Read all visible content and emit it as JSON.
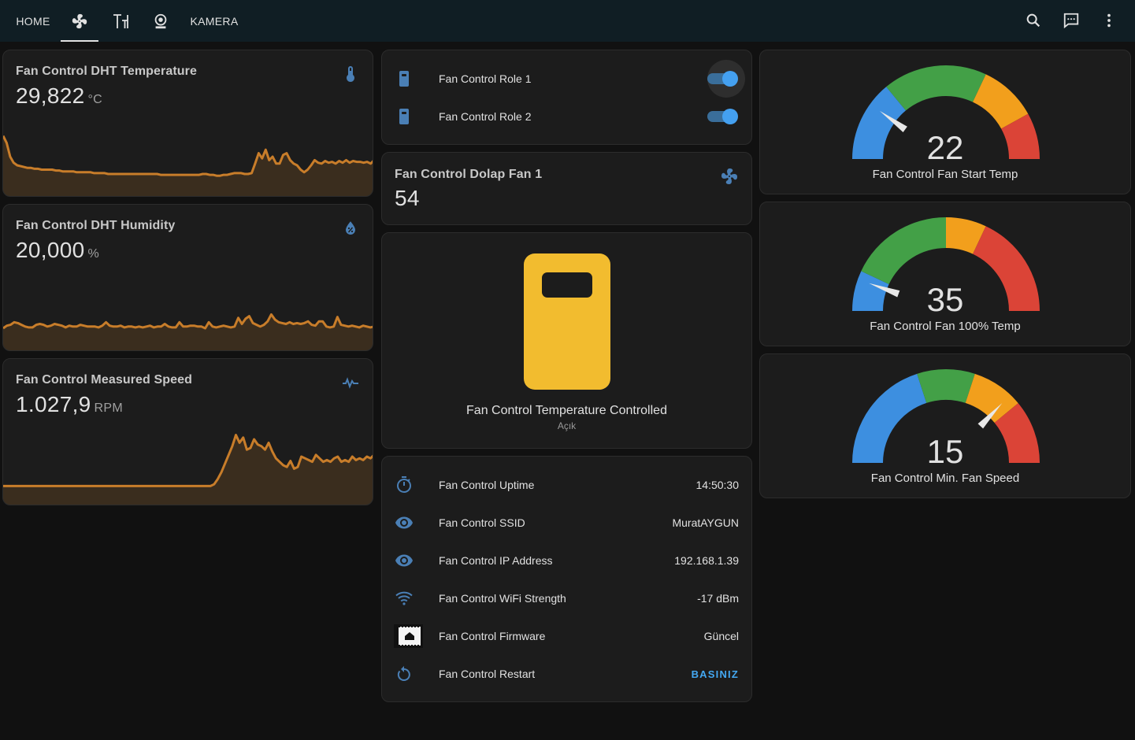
{
  "topbar": {
    "tabs": [
      {
        "label": "HOME",
        "kind": "text",
        "active": false
      },
      {
        "icon": "fan-icon",
        "active": true
      },
      {
        "icon": "text-tool-icon",
        "active": false
      },
      {
        "icon": "webcam-icon",
        "active": false
      },
      {
        "label": "KAMERA",
        "kind": "text",
        "active": false
      }
    ],
    "actions": [
      "search-icon",
      "message-icon",
      "more-vertical-icon"
    ]
  },
  "sensors": [
    {
      "name": "Fan Control DHT Temperature",
      "value": "29,822",
      "unit": "°C",
      "icon": "thermometer-icon",
      "history": [
        64,
        56,
        40,
        33,
        30,
        29,
        28,
        27,
        27,
        26,
        26,
        25,
        25,
        25,
        25,
        24,
        24,
        23,
        23,
        23,
        23,
        22,
        22,
        22,
        22,
        22,
        21,
        21,
        21,
        21,
        20,
        20,
        20,
        20,
        20,
        20,
        20,
        20,
        20,
        20,
        20,
        20,
        20,
        20,
        20,
        19,
        19,
        19,
        19,
        19,
        19,
        19,
        19,
        19,
        19,
        19,
        19,
        20,
        20,
        19,
        19,
        18,
        18,
        19,
        19,
        20,
        21,
        21,
        21,
        20,
        20,
        21,
        32,
        44,
        38,
        48,
        36,
        40,
        32,
        32,
        42,
        44,
        36,
        32,
        30,
        25,
        22,
        25,
        30,
        36,
        33,
        32,
        35,
        33,
        34,
        32,
        35,
        33,
        36,
        33,
        35,
        34,
        34,
        33,
        34,
        32,
        36
      ]
    },
    {
      "name": "Fan Control DHT Humidity",
      "value": "20,000",
      "unit": "%",
      "icon": "water-percent-icon",
      "history": [
        20,
        23,
        24,
        27,
        26,
        24,
        22,
        21,
        21,
        24,
        25,
        24,
        22,
        23,
        25,
        24,
        23,
        21,
        23,
        22,
        22,
        24,
        23,
        22,
        22,
        22,
        21,
        23,
        27,
        23,
        22,
        22,
        23,
        21,
        22,
        22,
        21,
        22,
        21,
        22,
        23,
        21,
        22,
        22,
        25,
        22,
        21,
        21,
        27,
        22,
        22,
        23,
        23,
        22,
        22,
        20,
        27,
        22,
        21,
        22,
        23,
        22,
        21,
        22,
        32,
        25,
        31,
        34,
        26,
        24,
        22,
        24,
        28,
        36,
        30,
        27,
        26,
        25,
        27,
        25,
        26,
        25,
        26,
        28,
        24,
        23,
        28,
        28,
        22,
        21,
        22,
        33,
        24,
        23,
        22,
        23,
        22,
        21,
        23,
        22,
        21,
        22
      ]
    },
    {
      "name": "Fan Control Measured Speed",
      "value": "1.027,9",
      "unit": "RPM",
      "icon": "pulse-icon",
      "history": [
        16,
        16,
        16,
        16,
        16,
        16,
        16,
        16,
        16,
        16,
        16,
        16,
        16,
        16,
        16,
        16,
        16,
        16,
        16,
        16,
        16,
        16,
        16,
        16,
        16,
        16,
        16,
        16,
        16,
        16,
        16,
        16,
        16,
        16,
        16,
        16,
        16,
        16,
        16,
        16,
        16,
        16,
        16,
        16,
        16,
        16,
        16,
        16,
        16,
        16,
        16,
        16,
        16,
        16,
        16,
        16,
        16,
        16,
        18,
        24,
        32,
        42,
        52,
        62,
        75,
        66,
        72,
        58,
        60,
        70,
        64,
        62,
        58,
        66,
        56,
        48,
        44,
        40,
        38,
        45,
        36,
        38,
        50,
        48,
        46,
        44,
        52,
        48,
        44,
        46,
        44,
        48,
        50,
        44,
        46,
        44,
        50,
        46,
        48,
        46,
        50,
        48,
        52
      ]
    }
  ],
  "switches": [
    {
      "name": "Fan Control Role 1",
      "icon": "relay-icon",
      "on": true
    },
    {
      "name": "Fan Control Role 2",
      "icon": "relay-icon",
      "on": true
    }
  ],
  "fan_card": {
    "name": "Fan Control Dolap Fan 1",
    "value": "54",
    "icon": "fan-icon"
  },
  "entity_card": {
    "name": "Fan Control Temperature Controlled",
    "state": "Açık",
    "color": "#f2bc2f"
  },
  "info_rows": [
    {
      "icon": "timer-icon",
      "label": "Fan Control Uptime",
      "value": "14:50:30",
      "button": false
    },
    {
      "icon": "eye-icon",
      "label": "Fan Control SSID",
      "value": "MuratAYGUN",
      "button": false
    },
    {
      "icon": "eye-icon",
      "label": "Fan Control IP Address",
      "value": "192.168.1.39",
      "button": false
    },
    {
      "icon": "wifi-icon",
      "label": "Fan Control WiFi Strength",
      "value": "-17 dBm",
      "button": false
    },
    {
      "icon": "firmware-icon",
      "label": "Fan Control Firmware",
      "value": "Güncel",
      "button": false
    },
    {
      "icon": "restart-icon",
      "label": "Fan Control Restart",
      "value": "BASINIZ",
      "button": true
    }
  ],
  "gauges": [
    {
      "name": "Fan Control Fan Start Temp",
      "value": "22",
      "level": 0.2,
      "segments": [
        {
          "to": 0.28,
          "color": "#3d8fe0"
        },
        {
          "to": 0.64,
          "color": "#43a047"
        },
        {
          "to": 0.84,
          "color": "#f29f1c"
        },
        {
          "to": 1,
          "color": "#db4437"
        }
      ]
    },
    {
      "name": "Fan Control Fan 100% Temp",
      "value": "35",
      "level": 0.11,
      "segments": [
        {
          "to": 0.14,
          "color": "#3d8fe0"
        },
        {
          "to": 0.5,
          "color": "#43a047"
        },
        {
          "to": 0.64,
          "color": "#f29f1c"
        },
        {
          "to": 1,
          "color": "#db4437"
        }
      ]
    },
    {
      "name": "Fan Control Min. Fan Speed",
      "value": "15",
      "level": 0.74,
      "segments": [
        {
          "to": 0.4,
          "color": "#3d8fe0"
        },
        {
          "to": 0.6,
          "color": "#43a047"
        },
        {
          "to": 0.78,
          "color": "#f29f1c"
        },
        {
          "to": 1,
          "color": "#db4437"
        }
      ]
    }
  ],
  "colors": {
    "accent": "#44a8f2",
    "graph": "#c87d2a",
    "icon_blue": "#4a7fb5"
  }
}
